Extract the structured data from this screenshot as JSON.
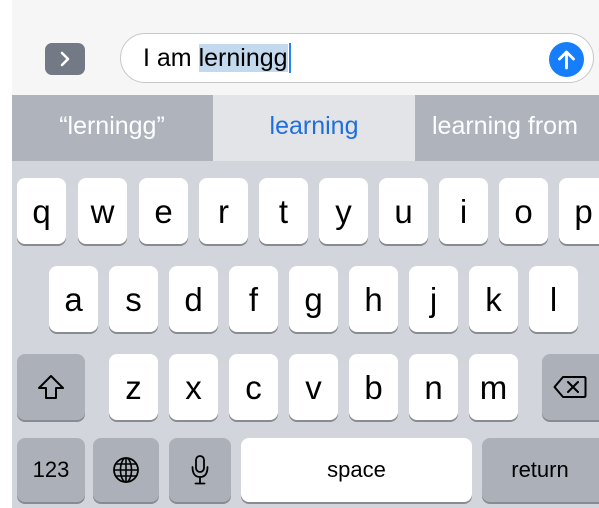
{
  "message_field": {
    "prefix_text": "I am ",
    "selected_text": "lerningg"
  },
  "predictions": [
    {
      "label": "“lerningg”"
    },
    {
      "label": "learning"
    },
    {
      "label": "learning from"
    }
  ],
  "keyboard": {
    "row1": [
      "q",
      "w",
      "e",
      "r",
      "t",
      "y",
      "u",
      "i",
      "o",
      "p"
    ],
    "row2": [
      "a",
      "s",
      "d",
      "f",
      "g",
      "h",
      "j",
      "k",
      "l"
    ],
    "row3": [
      "z",
      "x",
      "c",
      "v",
      "b",
      "n",
      "m"
    ],
    "numbers_label": "123",
    "space_label": "space",
    "return_label": "return"
  },
  "icons": {
    "expand": "chevron-right-icon",
    "send": "arrow-up-icon",
    "shift": "shift-icon",
    "delete": "delete-backward-icon",
    "globe": "globe-icon",
    "mic": "microphone-icon"
  },
  "colors": {
    "accent_blue": "#167efb",
    "prediction_active_text": "#1e6fdc",
    "selection_highlight": "#c3d9ee"
  }
}
